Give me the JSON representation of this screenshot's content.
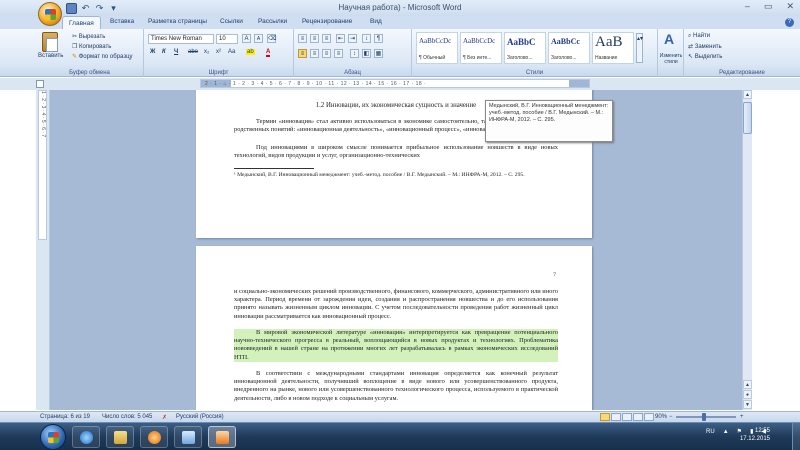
{
  "window": {
    "title": "Научная работа) - Microsoft Word",
    "qat": {
      "save": "■",
      "undo": "↶",
      "redo": "↷",
      "more": "▾"
    },
    "controls": {
      "minimize": "–",
      "maximize": "▭",
      "close": "✕"
    }
  },
  "tabs": [
    "Главная",
    "Вставка",
    "Разметка страницы",
    "Ссылки",
    "Рассылки",
    "Рецензирование",
    "Вид"
  ],
  "ribbon": {
    "clipboard": {
      "label": "Буфер обмена",
      "paste": "Вставить",
      "cut": "Вырезать",
      "copy": "Копировать",
      "format_painter": "Формат по образцу"
    },
    "font": {
      "label": "Шрифт",
      "font_name": "Times New Roman",
      "font_size": "10",
      "bold": "Ж",
      "italic": "К",
      "underline": "Ч",
      "strike": "abe",
      "subscript": "x₂",
      "superscript": "x²",
      "change_case": "Aa",
      "grow": "A",
      "shrink": "A",
      "highlight": "ab",
      "font_color": "A"
    },
    "paragraph": {
      "label": "Абзац",
      "show_marks": "¶"
    },
    "styles": {
      "label": "Стили",
      "items": [
        {
          "sample": "AaBbCcDc",
          "name": "¶ Обычный"
        },
        {
          "sample": "AaBbCcDc",
          "name": "¶ Без инте..."
        },
        {
          "sample": "AaBbC",
          "name": "Заголово..."
        },
        {
          "sample": "AaBbCc",
          "name": "Заголово..."
        },
        {
          "sample": "AaB",
          "name": "Название"
        }
      ],
      "change_styles": "Изменить стили"
    },
    "editing": {
      "label": "Редактирование",
      "find": "Найти",
      "replace": "Заменить",
      "select": "Выделить"
    }
  },
  "ruler": {
    "marks": "2 · 1 · ⌂ · 1 · 2 · 3 · 4 · 5 · 6 · 7 · 8 · 9 · 10 · 11 · 12 · 13 · 14 · 15 · 16 · 17 · 18 ·"
  },
  "vruler": {
    "marks": "1 · 2 · 3 · 4 · 5 · 6 · 7"
  },
  "document": {
    "page1": {
      "heading": "1.2 Инновации, их экономическая сущность и значение",
      "para1": "Термин «инновация» стал активно использоваться в экономике самостоятельно, так и для обозначения ряда родственных понятий: «инновационная деятельность», «инновационный процесс», «инновационное решение» и т.п.¹",
      "para2": "Под инновациями в широком смысле понимается прибыльное использование новшеств в виде новых технологий, видов продукции и услуг, организационно-технических",
      "footnote": "¹ Медынский, В.Г. Инновационный менеджмент: учеб.-метод. пособие / В.Г. Медынский. – М.: ИНФРА-М, 2012. – С. 295."
    },
    "page2": {
      "page_number": "7",
      "para1": "и социально-экономических решений производственного, финансового, коммерческого, административного или иного характера. Период времени от зарождения идеи, создания и распространения новшества и до его использования принято называть жизненным циклом инновации. С учетом последовательности проведения работ жизненный цикл инновации рассматривается как инновационный процесс.",
      "para2": "В мировой экономической литературе «инновация» интерпретируется как превращение потенциального научно-технического прогресса в реальный, воплощающийся в новых продуктах и технологиях. Проблематика нововведений в нашей стране на протяжении многих лет разрабатывалась в рамках экономических исследований НТП.",
      "para3": "В соответствии с международными стандартами инновация определяется как конечный результат инновационной деятельности, получивший воплощение в виде нового или усовершенствованного продукта, внедренного на рынке, нового или усовершенствованного технологического процесса, используемого в практической деятельности, либо в новом подходе к социальным услугам."
    }
  },
  "tooltip": {
    "text": "Медынский, В.Г. Инновационный менеджмент: учеб.-метод. пособие / В.Г. Медынский. – М.: ИНФРА-М, 2012. – С. 295."
  },
  "status": {
    "page": "Страница: 6 из 19",
    "words": "Число слов: 5 045",
    "language": "Русский (Россия)",
    "zoom": "90%"
  },
  "taskbar": {
    "language": "RU",
    "time": "12:55",
    "date": "17.12.2015"
  }
}
